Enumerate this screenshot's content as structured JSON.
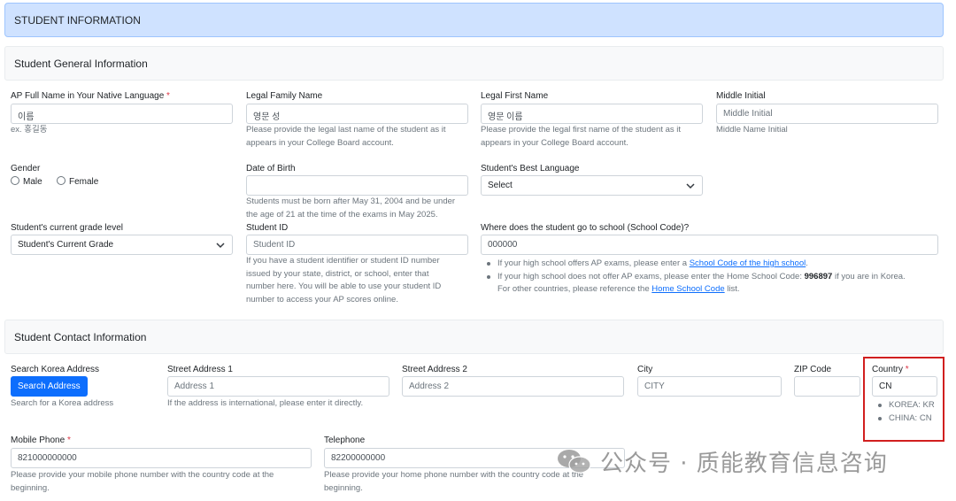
{
  "header": {
    "title": "STUDENT INFORMATION"
  },
  "general": {
    "title": "Student General Information",
    "native_name": {
      "label": "AP Full Name in Your Native Language",
      "required": "*",
      "value": "이름",
      "help": "ex. 홍길동"
    },
    "family_name": {
      "label": "Legal Family Name",
      "value": "영문 성",
      "help1": "Please provide the legal last name of the student as it",
      "help2": "appears in your College Board account."
    },
    "first_name": {
      "label": "Legal First Name",
      "value": "영문 이름",
      "help1": "Please provide the legal first name of the student as it",
      "help2": "appears in your College Board account."
    },
    "middle": {
      "label": "Middle Initial",
      "placeholder": "Middle Initial",
      "help": "Middle Name Initial"
    },
    "gender": {
      "label": "Gender",
      "options": [
        "Male",
        "Female"
      ]
    },
    "dob": {
      "label": "Date of Birth",
      "help1": "Students must be born after May 31, 2004 and be under",
      "help2": "the age of 21 at the time of the exams in May 2025."
    },
    "language": {
      "label": "Student's Best Language",
      "selected": "Select"
    },
    "grade": {
      "label": "Student's current grade level",
      "selected": "Student's Current Grade"
    },
    "student_id": {
      "label": "Student ID",
      "placeholder": "Student ID",
      "help1": "If you have a student identifier or student ID number",
      "help2": "issued by your state, district, or school, enter that",
      "help3": "number here. You will be able to use your student ID",
      "help4": "number to access your AP scores online."
    },
    "school": {
      "label": "Where does the student go to school (School Code)?",
      "value": "000000",
      "bullet1_pre": "If your high school offers AP exams, please enter a ",
      "bullet1_link": "School Code of the high school",
      "bullet1_post": ".",
      "bullet2_pre": "If your high school does not offer AP exams, please enter the Home School Code: ",
      "bullet2_code": "996897",
      "bullet2_post": " if you are in Korea.",
      "bullet2_line2_pre": "For other countries, please reference the ",
      "bullet2_link": "Home School Code",
      "bullet2_line2_post": " list."
    }
  },
  "contact": {
    "title": "Student Contact Information",
    "search": {
      "label": "Search Korea Address",
      "button": "Search Address",
      "help": "Search for a Korea address"
    },
    "street1": {
      "label": "Street Address 1",
      "placeholder": "Address 1",
      "help": "If the address is international, please enter it directly."
    },
    "street2": {
      "label": "Street Address 2",
      "placeholder": "Address 2"
    },
    "city": {
      "label": "City",
      "placeholder": "CITY"
    },
    "zip": {
      "label": "ZIP Code",
      "value": ""
    },
    "country": {
      "label": "Country",
      "required": "*",
      "value": "CN",
      "hints": [
        "KOREA: KR",
        "CHINA: CN"
      ]
    },
    "mobile": {
      "label": "Mobile Phone",
      "required": "*",
      "value": "821000000000",
      "help1": "Please provide your mobile phone number with the country code at the",
      "help2": "beginning."
    },
    "telephone": {
      "label": "Telephone",
      "value": "82200000000",
      "help1": "Please provide your home phone number with the country code at the",
      "help2": "beginning."
    }
  },
  "watermark": {
    "text": "公众号 · 质能教育信息咨询"
  },
  "colors": {
    "accent": "#0d6efd",
    "header_bg": "#cfe2ff",
    "highlight": "#d11f1f",
    "required": "#dc3545"
  },
  "icons": [
    "chevron-down-icon",
    "radio-icon",
    "wechat-icon"
  ]
}
